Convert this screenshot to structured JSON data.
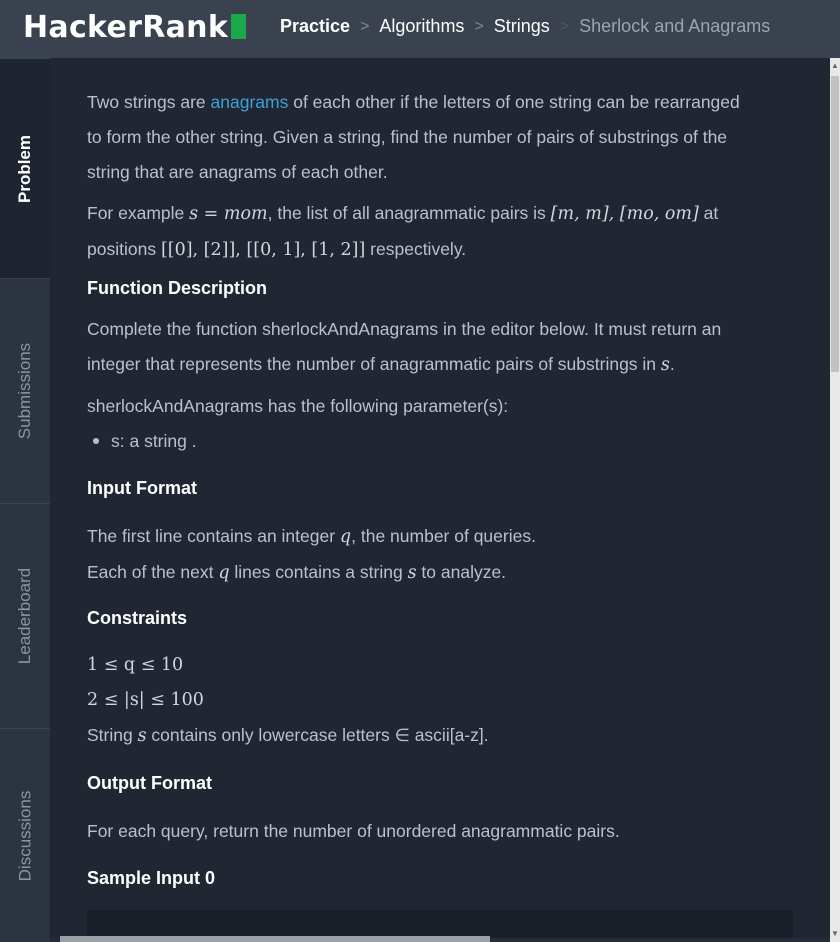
{
  "header": {
    "logo_text": "HackerRank",
    "breadcrumb": [
      {
        "label": "Practice"
      },
      {
        "label": "Algorithms"
      },
      {
        "label": "Strings"
      },
      {
        "label": "Sherlock and Anagrams"
      }
    ]
  },
  "sidebar": {
    "tabs": [
      {
        "label": "Problem",
        "active": true
      },
      {
        "label": "Submissions",
        "active": false
      },
      {
        "label": "Leaderboard",
        "active": false
      },
      {
        "label": "Discussions",
        "active": false
      }
    ]
  },
  "problem": {
    "intro_before_link": "Two strings are ",
    "intro_link": "anagrams",
    "intro_after_link": " of each other if the letters of one string can be rearranged",
    "intro_line2": "to form the other string. Given a string, find the number of pairs of substrings of the",
    "intro_line3": "string that are anagrams of each other.",
    "example_prefix": "For example ",
    "example_math_s": "s",
    "example_math_eq": " = ",
    "example_math_val": "mom",
    "example_mid": ", the list of all anagrammatic pairs is ",
    "example_pairs": "[m, m], [mo, om]",
    "example_at": " at",
    "example_positions_prefix": "positions ",
    "example_positions": "[[0], [2]], [[0, 1], [1, 2]]",
    "example_respectively": " respectively.",
    "function_heading": "Function Description",
    "function_line1": "Complete the function sherlockAndAnagrams in the editor below. It must return an",
    "function_line2_prefix": "integer that represents the number of anagrammatic pairs of substrings in ",
    "function_line2_var": "s",
    "function_line2_suffix": ".",
    "params_intro": "sherlockAndAnagrams has the following parameter(s):",
    "params": [
      "s: a string ."
    ],
    "input_heading": "Input Format",
    "input_line1_prefix": "The first line contains an integer ",
    "input_line1_var": "q",
    "input_line1_suffix": ", the number of queries.",
    "input_line2_prefix": "Each of the next ",
    "input_line2_var": "q",
    "input_line2_mid": " lines contains a string ",
    "input_line2_var2": "s",
    "input_line2_suffix": " to analyze.",
    "constraints_heading": "Constraints",
    "constraint1": "1 ≤ q ≤ 10",
    "constraint2": "2 ≤ |s| ≤ 100",
    "constraint3_prefix": "String ",
    "constraint3_var": "s",
    "constraint3_suffix": " contains only lowercase letters ∈ ascii[a-z].",
    "output_heading": "Output Format",
    "output_line": "For each query, return the number of unordered anagrammatic pairs.",
    "sample_heading": "Sample Input 0"
  }
}
